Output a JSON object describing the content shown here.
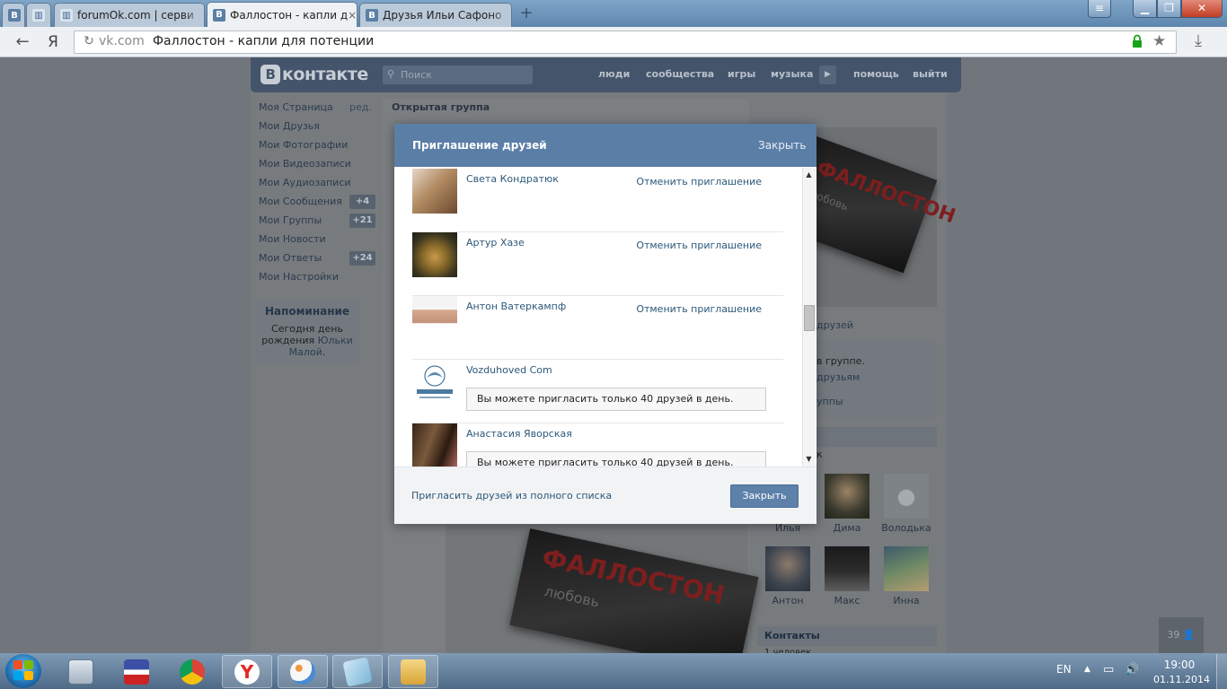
{
  "browser": {
    "tabs": [
      {
        "icon": "В",
        "label": ""
      },
      {
        "icon": "",
        "label": ""
      },
      {
        "icon": "",
        "label": "forumOk.com | серви"
      },
      {
        "icon": "В",
        "label": "Фаллостон - капли д"
      },
      {
        "icon": "В",
        "label": "Друзья Ильи Сафоно"
      }
    ],
    "tab_close_glyph": "×",
    "new_tab_glyph": "+",
    "url_domain": "vk.com",
    "url_title": "Фаллостон - капли для потенции",
    "yandex_glyph": "Я"
  },
  "vk": {
    "logo_letter": "В",
    "logo_text": "контакте",
    "search_placeholder": "Поиск",
    "nav": [
      "люди",
      "сообщества",
      "игры",
      "музыка",
      "помощь",
      "выйти"
    ],
    "sidebar": [
      {
        "label": "Моя Страница",
        "extra": "ред."
      },
      {
        "label": "Мои Друзья"
      },
      {
        "label": "Мои Фотографии"
      },
      {
        "label": "Мои Видеозаписи"
      },
      {
        "label": "Мои Аудиозаписи"
      },
      {
        "label": "Мои Сообщения",
        "badge": "+4"
      },
      {
        "label": "Мои Группы",
        "badge": "+21"
      },
      {
        "label": "Мои Новости"
      },
      {
        "label": "Мои Ответы",
        "badge": "+24"
      },
      {
        "label": "Мои Настройки"
      }
    ],
    "reminder": {
      "title": "Напоминание",
      "text_before": "Сегодня ",
      "text_bold": "день рождения",
      "text_link": "Юльки Малой",
      "text_after": "."
    },
    "group_label": "Открытая группа",
    "product": {
      "brand": "ФАЛЛОСТОН",
      "sub": "любовь"
    },
    "right_partial": {
      "friends_link": "друзей",
      "in_group": "в группе.",
      "to_friends": "друзьям",
      "groups": "уппы",
      "letter": "к",
      "contacts_title": "Контакты",
      "contacts_sub": "1 человек"
    },
    "friends": [
      {
        "name": "Илья"
      },
      {
        "name": "Дима"
      },
      {
        "name": "Володька"
      },
      {
        "name": "Антон"
      },
      {
        "name": "Макс"
      },
      {
        "name": "Инна"
      }
    ],
    "counter": "39"
  },
  "modal": {
    "title": "Приглашение друзей",
    "close_link": "Закрыть",
    "rows": [
      {
        "name": "Света Кондратюк",
        "action": "Отменить приглашение"
      },
      {
        "name": "Артур Хазе",
        "action": "Отменить приглашение"
      },
      {
        "name": "Антон Ватеркампф",
        "action": "Отменить приглашение"
      },
      {
        "name": "Vozduhoved Com",
        "notice": "Вы можете пригласить только 40 друзей в день."
      },
      {
        "name": "Анастасия Яворская",
        "notice": "Вы можете пригласить только 40 друзей в день."
      }
    ],
    "invite_all_link": "Пригласить друзей из полного списка",
    "close_button": "Закрыть"
  },
  "taskbar": {
    "lang": "EN",
    "time": "19:00",
    "date": "01.11.2014"
  },
  "colors": {
    "vk_header": "#44546a",
    "modal_header": "#5b7ea7",
    "link": "#2b587a",
    "button": "#5d81a9"
  }
}
